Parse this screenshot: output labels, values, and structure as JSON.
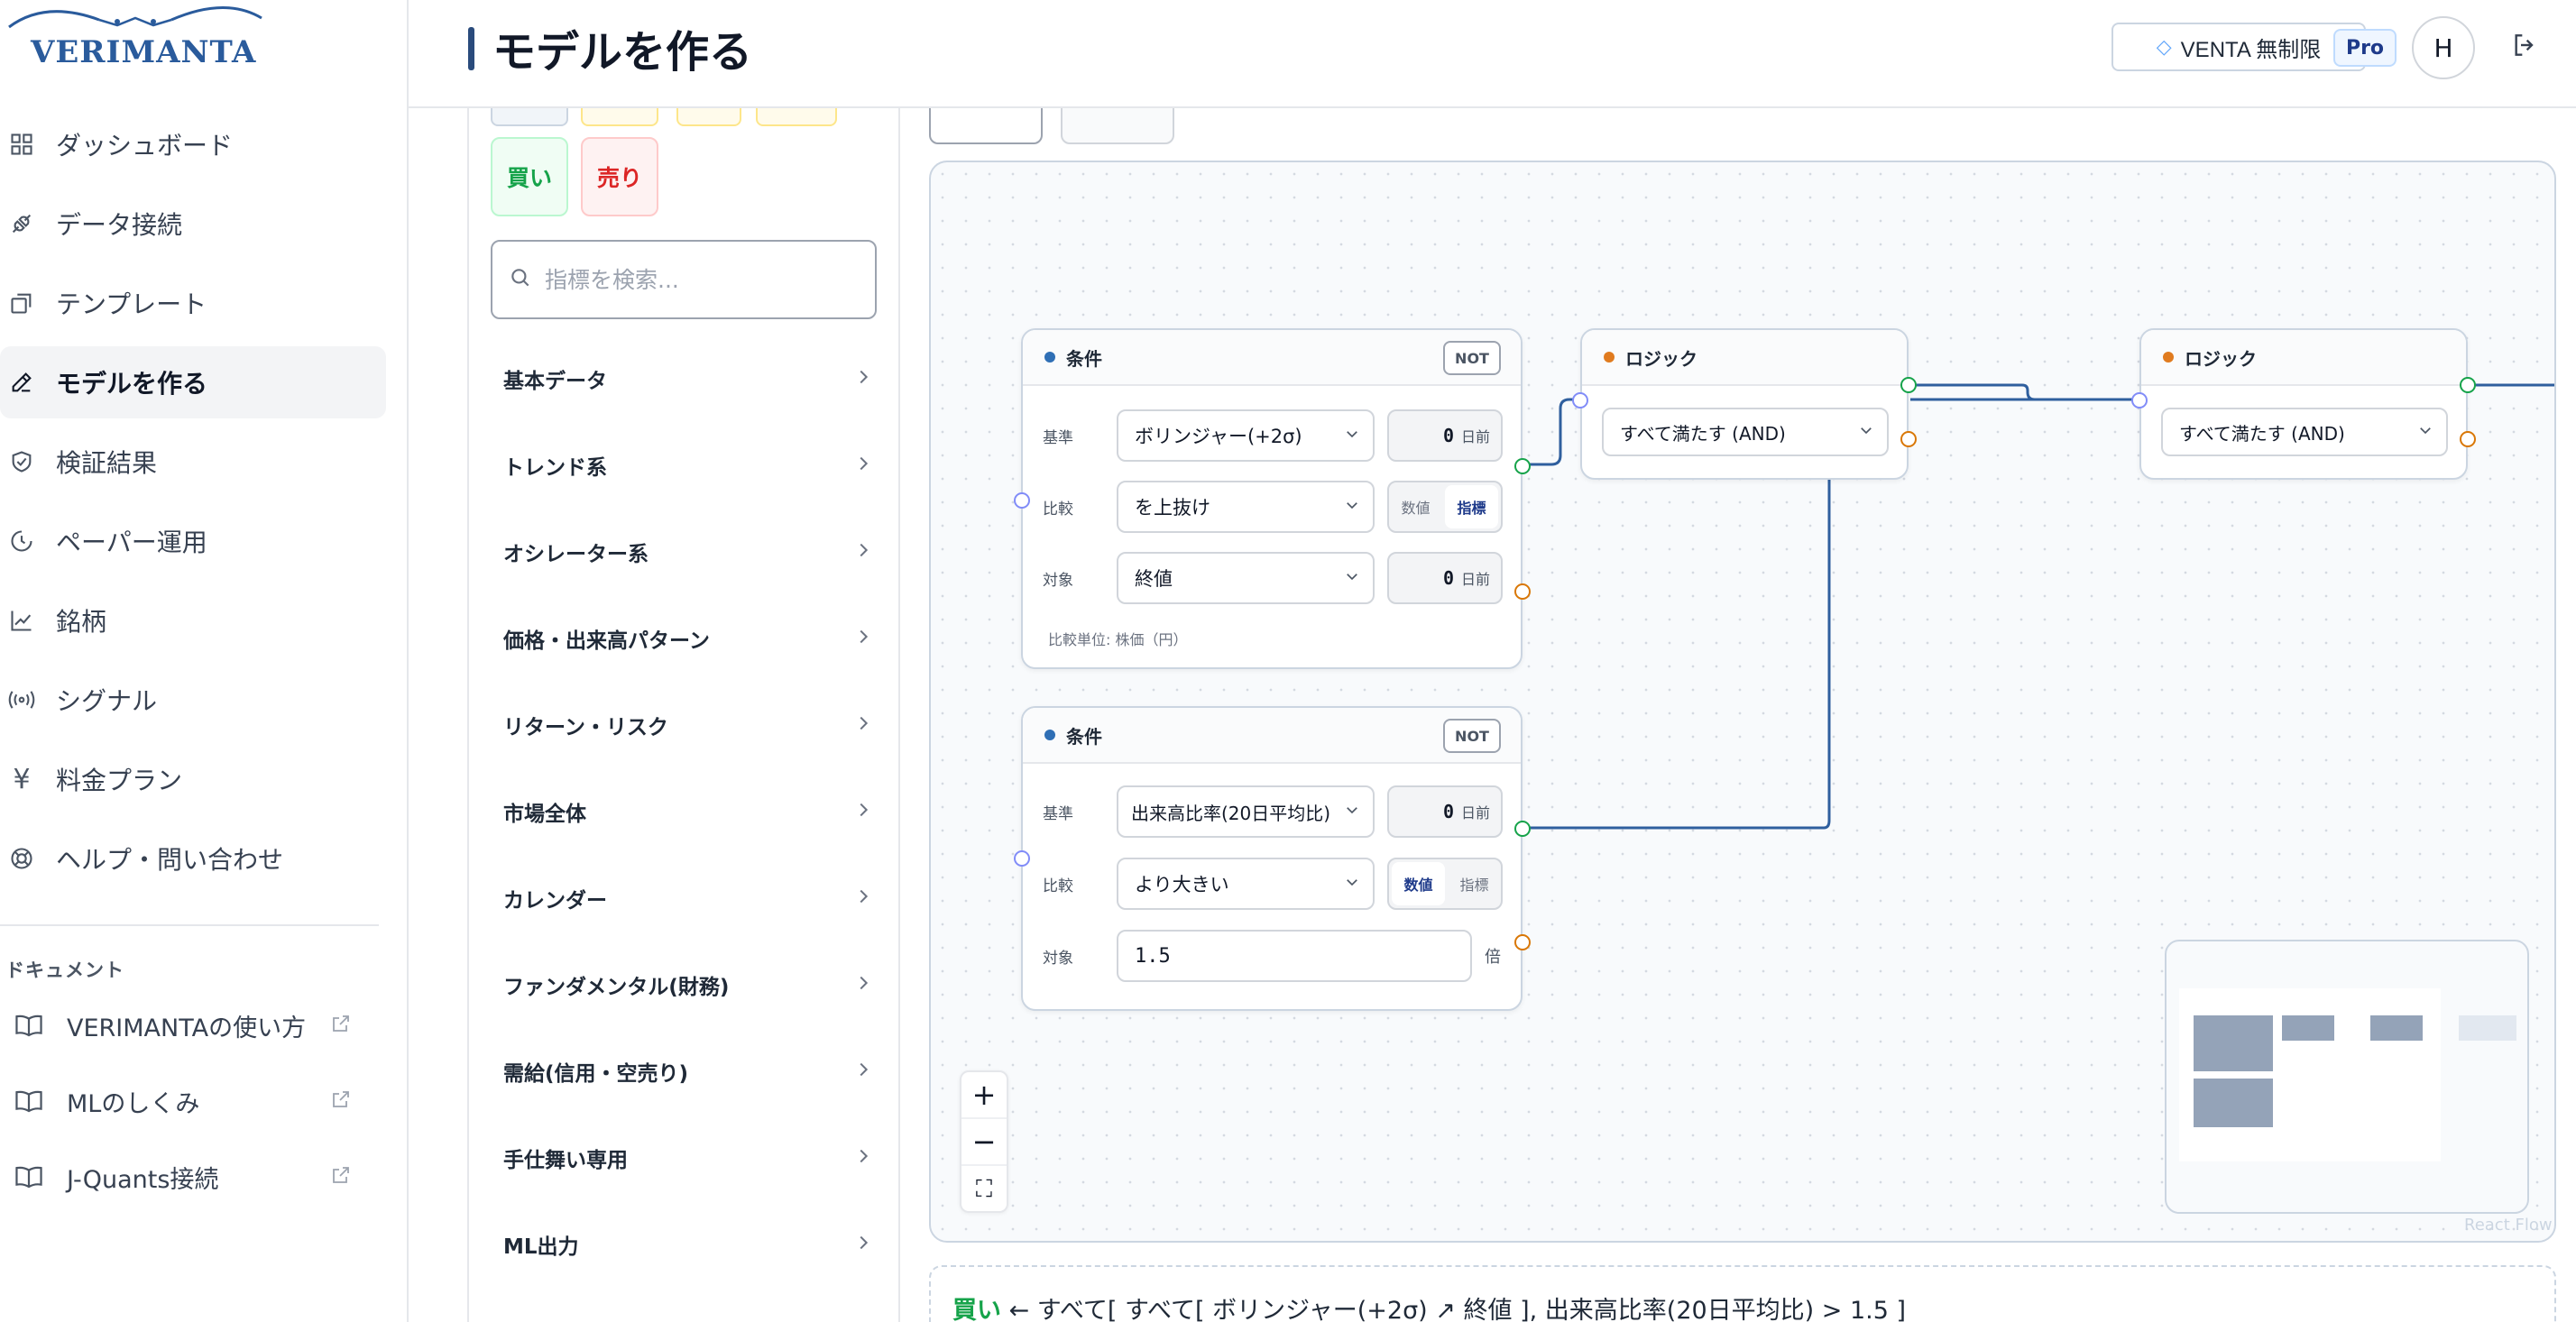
{
  "brand": {
    "name": "VERIMANTA"
  },
  "header": {
    "title": "モデルを作る",
    "venta_label": "VENTA 無制限",
    "plan_badge": "Pro",
    "avatar_initial": "H"
  },
  "sidebar": {
    "items": [
      {
        "label": "ダッシュボード",
        "icon": "grid-icon"
      },
      {
        "label": "データ接続",
        "icon": "plug-icon"
      },
      {
        "label": "テンプレート",
        "icon": "copy-icon"
      },
      {
        "label": "モデルを作る",
        "icon": "pencil-icon",
        "active": true
      },
      {
        "label": "検証結果",
        "icon": "shield-check-icon"
      },
      {
        "label": "ペーパー運用",
        "icon": "clock-icon"
      },
      {
        "label": "銘柄",
        "icon": "chart-line-icon"
      },
      {
        "label": "シグナル",
        "icon": "broadcast-icon"
      },
      {
        "label": "料金プラン",
        "icon": "yen-icon"
      },
      {
        "label": "ヘルプ・問い合わせ",
        "icon": "lifebuoy-icon"
      }
    ],
    "docs_heading": "ドキュメント",
    "docs": [
      {
        "label": "VERIMANTAの使い方"
      },
      {
        "label": "MLのしくみ"
      },
      {
        "label": "J-Quants接続"
      }
    ]
  },
  "palette": {
    "buy_label": "買い",
    "sell_label": "売り",
    "search_placeholder": "指標を検索...",
    "categories": [
      "基本データ",
      "トレンド系",
      "オシレーター系",
      "価格・出来高パターン",
      "リターン・リスク",
      "市場全体",
      "カレンダー",
      "ファンダメンタル(財務)",
      "需給(信用・空売り)",
      "手仕舞い専用",
      "ML出力"
    ]
  },
  "nodes": {
    "cond1": {
      "title": "条件",
      "not_label": "NOT",
      "base_label": "基準",
      "base_value": "ボリンジャー(+2σ)",
      "base_days": "0",
      "days_unit": "日前",
      "compare_label": "比較",
      "compare_value": "を上抜け",
      "seg_value": "数値",
      "seg_indicator": "指標",
      "target_label": "対象",
      "target_value": "終値",
      "target_days": "0",
      "unit_note": "比較単位: 株価（円）"
    },
    "cond2": {
      "title": "条件",
      "not_label": "NOT",
      "base_label": "基準",
      "base_value": "出来高比率(20日平均比)",
      "base_days": "0",
      "days_unit": "日前",
      "compare_label": "比較",
      "compare_value": "より大きい",
      "seg_value": "数値",
      "seg_indicator": "指標",
      "target_label": "対象",
      "target_value": "1.5",
      "target_unit": "倍"
    },
    "logic1": {
      "title": "ロジック",
      "value": "すべて満たす (AND)"
    },
    "logic2": {
      "title": "ロジック",
      "value": "すべて満たす (AND)"
    }
  },
  "canvas": {
    "attribution": "React Flow",
    "zoom_in": "+",
    "zoom_out": "−",
    "fit": "⛶"
  },
  "expression": {
    "side": "買い",
    "arrow": " ← ",
    "text": "すべて[ すべて[ ボリンジャー(+2σ) ↗ 終値 ], 出来高比率(20日平均比) > 1.5 ]"
  },
  "colors": {
    "accent": "#2a4b7c",
    "buy": "#16a34a",
    "sell": "#dc2626",
    "edge": "#2f5f9e"
  }
}
